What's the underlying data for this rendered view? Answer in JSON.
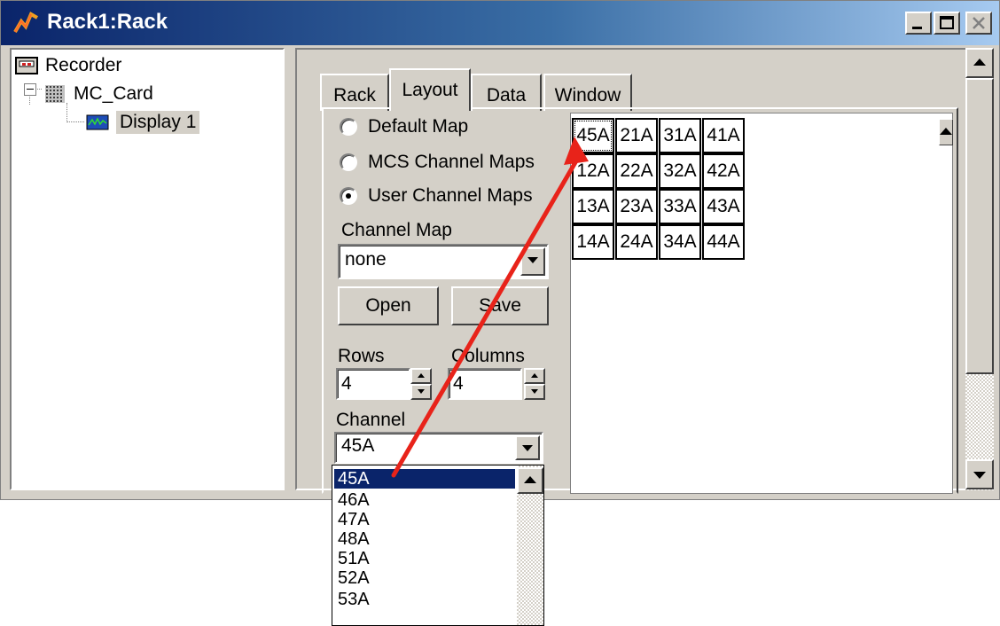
{
  "window": {
    "title": "Rack1:Rack"
  },
  "tree": {
    "items": [
      {
        "label": "Recorder"
      },
      {
        "label": "MC_Card"
      },
      {
        "label": "Display 1"
      }
    ]
  },
  "tabs": [
    {
      "label": "Rack"
    },
    {
      "label": "Layout"
    },
    {
      "label": "Data"
    },
    {
      "label": "Window"
    }
  ],
  "layout": {
    "map_options": [
      {
        "label": "Default Map",
        "selected": false
      },
      {
        "label": "MCS Channel Maps",
        "selected": false
      },
      {
        "label": "User Channel Maps",
        "selected": true
      }
    ],
    "channel_map_label": "Channel Map",
    "channel_map_value": "none",
    "open_label": "Open",
    "save_label": "Save",
    "rows_label": "Rows",
    "rows_value": "4",
    "columns_label": "Columns",
    "columns_value": "4",
    "channel_label": "Channel",
    "channel_value": "45A",
    "channel_options": [
      "45A",
      "46A",
      "47A",
      "48A",
      "51A",
      "52A",
      "53A"
    ]
  },
  "grid": {
    "rows": [
      [
        "45A",
        "21A",
        "31A",
        "41A"
      ],
      [
        "12A",
        "22A",
        "32A",
        "42A"
      ],
      [
        "13A",
        "23A",
        "33A",
        "43A"
      ],
      [
        "14A",
        "24A",
        "34A",
        "44A"
      ]
    ]
  },
  "colors": {
    "arrow": "#e8231a",
    "selection": "#0a246a",
    "face": "#d4d0c8"
  }
}
